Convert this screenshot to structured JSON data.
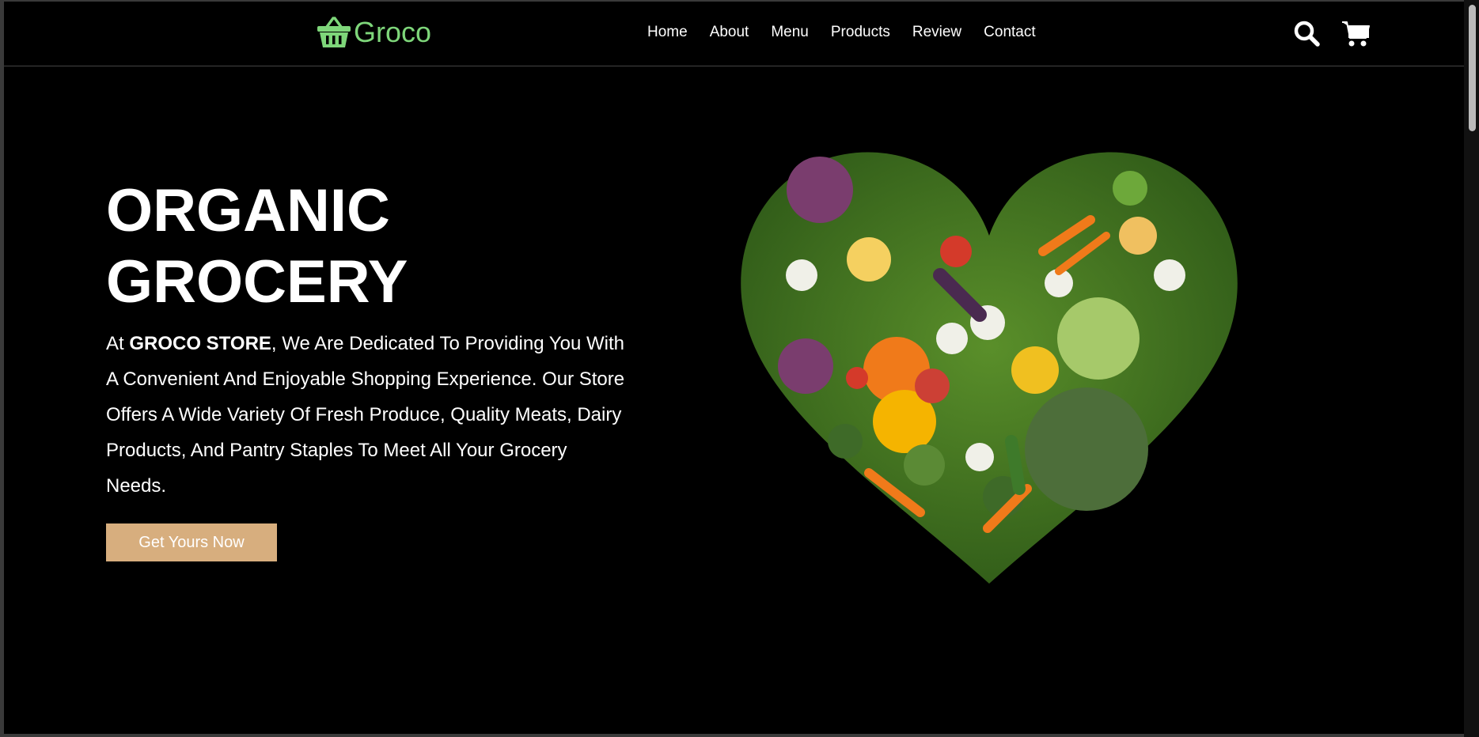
{
  "brand": {
    "name": "Groco",
    "color": "#7ed67a"
  },
  "nav": {
    "items": [
      "Home",
      "About",
      "Menu",
      "Products",
      "Review",
      "Contact"
    ]
  },
  "header_icons": {
    "search": "search-icon",
    "cart": "cart-icon"
  },
  "hero": {
    "title_line1": "ORGANIC",
    "title_line2": "GROCERY",
    "text_prefix": "At ",
    "text_brand": "GROCO STORE",
    "text_body": ", We Are Dedicated To Providing You With A Convenient And Enjoyable Shopping Experience. Our Store Offers A Wide Variety Of Fresh Produce, Quality Meats, Dairy Products, And Pantry Staples To Meet All Your Grocery Needs.",
    "button_label": "Get Yours Now",
    "button_color": "#d7ae7e"
  }
}
